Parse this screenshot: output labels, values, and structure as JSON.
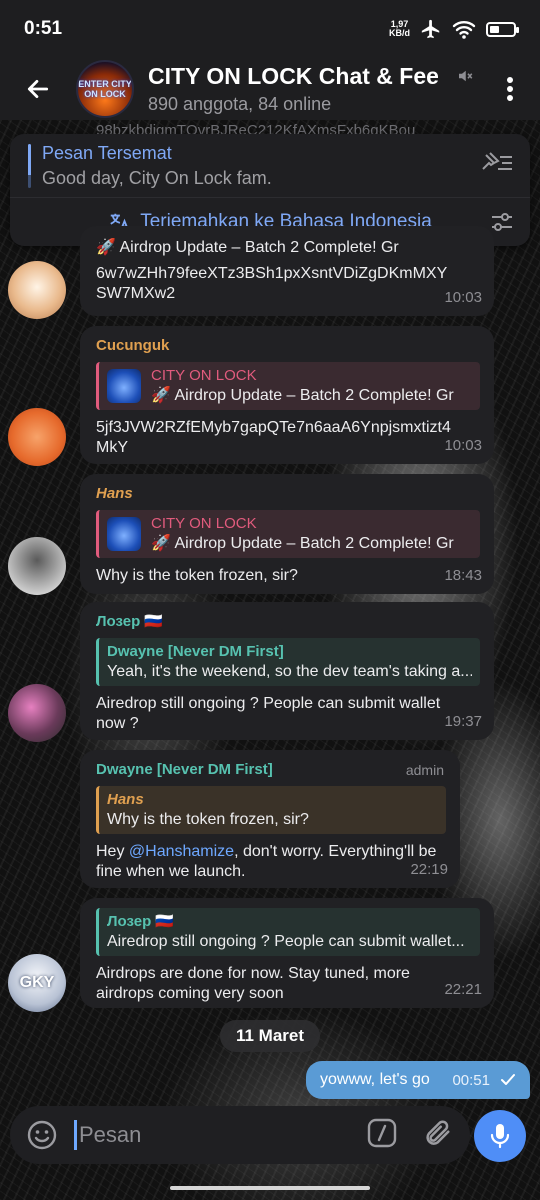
{
  "status_bar": {
    "time": "0:51",
    "speed_value": "1,97",
    "speed_unit": "KB/d"
  },
  "header": {
    "title": "CITY ON LOCK Chat & Fee",
    "subtitle": "890 anggota, 84 online",
    "avatar_text": "ENTER CITY ON LOCK"
  },
  "faded_text": "98bzkbdiqmTQvrBJReC212KfAXmsFxb6qKBou",
  "pinned": {
    "title": "Pesan Tersemat",
    "message": "Good day, City On Lock fam.",
    "translate_label": "Terjemahkan ke Bahasa Indonesia"
  },
  "messages": [
    {
      "reply_text": "🚀 Airdrop Update – Batch 2 Complete!  Gr",
      "body": "6w7wZHh79feeXTz3BSh1pxXsntVDiZgDKmMXYSW7MXw2",
      "time": "10:03"
    },
    {
      "sender": "Cucunguk",
      "reply_name": "CITY ON LOCK",
      "reply_text": "🚀 Airdrop Update – Batch 2 Complete!  Gr",
      "body": "5jf3JVW2RZfEMyb7gapQTe7n6aaA6Ynpjsmxtizt4MkY",
      "time": "10:03"
    },
    {
      "sender": "Hans",
      "reply_name": "CITY ON LOCK",
      "reply_text": "🚀 Airdrop Update – Batch 2 Complete!  Gr",
      "body": "Why is the token frozen, sir?",
      "time": "18:43"
    },
    {
      "sender": "Лозер 🇷🇺",
      "reply_name": "Dwayne [Never DM First]",
      "reply_text": "Yeah, it's the weekend, so the dev team's taking a...",
      "body": "Airedrop still ongoing ? People can submit wallet now ?",
      "time": "19:37"
    },
    {
      "sender": "Dwayne [Never DM First]",
      "admin": "admin",
      "reply_name": "Hans",
      "reply_text": "Why is the token frozen, sir?",
      "body_prefix": "Hey ",
      "mention": "@Hanshamize",
      "body_suffix": ", don't worry. Everything'll be fine when we launch.",
      "time": "22:19"
    },
    {
      "reply_name": "Лозер 🇷🇺",
      "reply_text": "Airedrop still ongoing ? People can submit wallet...",
      "body": "Airdrops are done for now. Stay tuned, more airdrops coming very soon",
      "time": "22:21",
      "avatar_text": "GKY"
    }
  ],
  "date_divider": "11 Maret",
  "outgoing": {
    "text": "yowww, let's go",
    "time": "00:51"
  },
  "input": {
    "placeholder": "Pesan"
  },
  "colors": {
    "accent": "#7fa8f5",
    "outgoing_bubble": "#5a9bd5",
    "mic_button": "#4f8ef7",
    "sender_cucunguk": "#e0a050",
    "sender_lozer": "#57c2b0",
    "sender_dwayne": "#57c2b0"
  }
}
